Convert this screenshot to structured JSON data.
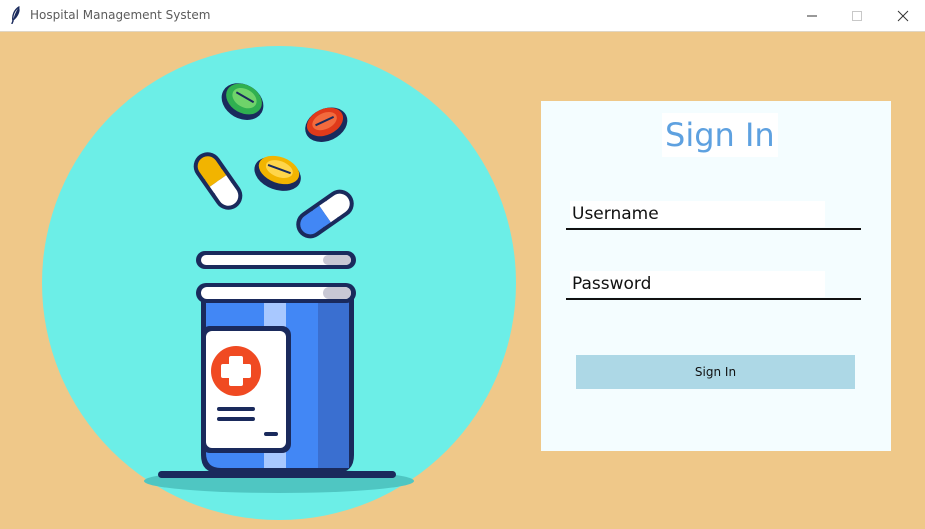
{
  "window": {
    "title": "Hospital Management System",
    "controls": {
      "minimize_icon": "minimize-icon",
      "maximize_icon": "maximize-icon",
      "close_icon": "close-icon"
    }
  },
  "illustration": {
    "description_icon": "medicine-bottle-with-pills",
    "colors": {
      "background": "#efc889",
      "circle": "#6ceee7",
      "bottle": "#4287f5",
      "outline": "#1a2a5c",
      "cross": "#f04a22"
    }
  },
  "login": {
    "title": "Sign In",
    "username_placeholder": "Username",
    "password_placeholder": "Password",
    "submit_label": "Sign In",
    "colors": {
      "panel": "#f4fdff",
      "title": "#5ea1e0",
      "button": "#add8e6"
    }
  }
}
